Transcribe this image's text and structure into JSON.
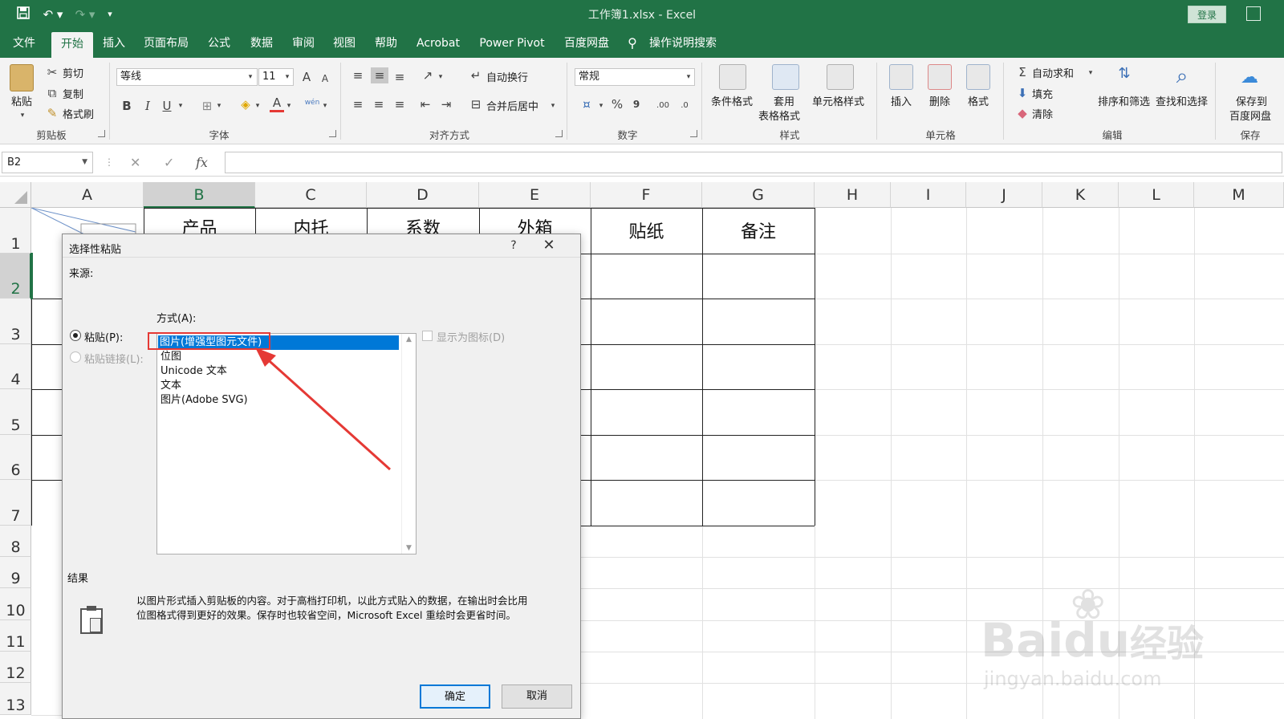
{
  "window": {
    "title": "工作簿1.xlsx  -  Excel",
    "login_label": "登录"
  },
  "quick_access": {
    "save_icon": "save-icon",
    "undo_icon": "undo-icon",
    "redo_icon": "redo-icon"
  },
  "tabs": [
    "文件",
    "开始",
    "插入",
    "页面布局",
    "公式",
    "数据",
    "审阅",
    "视图",
    "帮助",
    "Acrobat",
    "Power Pivot",
    "百度网盘"
  ],
  "tell_me": "操作说明搜索",
  "ribbon": {
    "clipboard": {
      "paste": "粘贴",
      "cut": "剪切",
      "copy": "复制",
      "format_painter": "格式刷",
      "group": "剪贴板"
    },
    "font": {
      "name": "等线",
      "size": "11",
      "group": "字体",
      "bold": "B",
      "italic": "I",
      "underline": "U",
      "grow": "A",
      "shrink": "A",
      "phonetic": "wén"
    },
    "alignment": {
      "wrap": "自动换行",
      "merge": "合并后居中",
      "group": "对齐方式"
    },
    "number": {
      "format": "常规",
      "percent": "%",
      "comma": "9",
      "inc_decimal": ".00",
      "dec_decimal": ".0",
      "group": "数字"
    },
    "styles": {
      "conditional": "条件格式",
      "table_a": "套用",
      "table_b": "表格格式",
      "cell_styles": "单元格样式",
      "group": "样式"
    },
    "cells": {
      "insert": "插入",
      "delete": "删除",
      "format": "格式",
      "group": "单元格"
    },
    "editing": {
      "autosum": "自动求和",
      "fill": "填充",
      "clear": "清除",
      "sort": "排序和筛选",
      "find": "查找和选择",
      "group": "编辑"
    },
    "save": {
      "label_a": "保存到",
      "label_b": "百度网盘",
      "group": "保存"
    }
  },
  "formula_bar": {
    "name_box": "B2",
    "fx": "fx",
    "cancel": "✕",
    "enter": "✓"
  },
  "columns": [
    "A",
    "B",
    "C",
    "D",
    "E",
    "F",
    "G",
    "H",
    "I",
    "J",
    "K",
    "L",
    "M"
  ],
  "rows": [
    "1",
    "2",
    "3",
    "4",
    "5",
    "6",
    "7",
    "8",
    "9",
    "10",
    "11",
    "12",
    "13"
  ],
  "sheet_headers": {
    "B": "产品",
    "C": "内托",
    "D": "系数",
    "E": "外箱",
    "F": "贴纸",
    "G": "备注"
  },
  "dialog": {
    "title": "选择性粘贴",
    "help": "?",
    "close": "✕",
    "source_label": "来源:",
    "as_label": "方式(A):",
    "paste_option": "粘贴(P):",
    "paste_link_option": "粘贴链接(L):",
    "display_as_icon": "显示为图标(D)",
    "list_items": [
      "图片(增强型图元文件)",
      "位图",
      "Unicode 文本",
      "文本",
      "图片(Adobe SVG)"
    ],
    "selected_index": 0,
    "result_label": "结果",
    "result_line1": "以图片形式插入剪贴板的内容。对于高档打印机，以此方式贴入的数据，在输出时会比用",
    "result_line2": "位图格式得到更好的效果。保存时也较省空间，Microsoft Excel 重绘时会更省时间。",
    "ok": "确定",
    "cancel": "取消"
  },
  "watermark": {
    "brand": "Bai",
    "suffix": "du",
    "cn": "经验",
    "url": "jingyan.baidu.com"
  },
  "colors": {
    "excel_green": "#217346",
    "selection_blue": "#0078d7",
    "annotation_red": "#e53935"
  }
}
